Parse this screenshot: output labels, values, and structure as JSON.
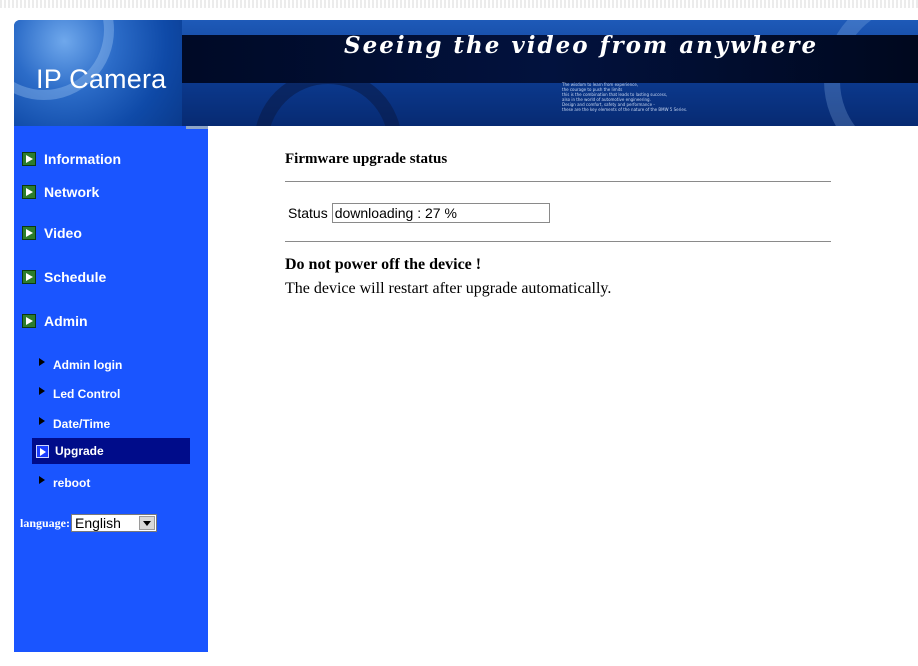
{
  "banner": {
    "title": "IP Camera",
    "slogan": "Seeing the video from anywhere",
    "fine_print": [
      "The wisdom to learn from experience,",
      "the courage to push the limits",
      "this is the combination that leads to lasting success,",
      "also in the world of automotive engineering.",
      "Design and comfort, safety and performance -",
      "these are the key elements of the nature of the BMW 5 Series."
    ]
  },
  "sidebar": {
    "menu": [
      {
        "label": "Information"
      },
      {
        "label": "Network"
      },
      {
        "label": "Video"
      },
      {
        "label": "Schedule"
      },
      {
        "label": "Admin"
      }
    ],
    "admin_submenu": [
      {
        "label": "Admin login",
        "active": false
      },
      {
        "label": "Led Control",
        "active": false
      },
      {
        "label": "Date/Time",
        "active": false
      },
      {
        "label": "Upgrade",
        "active": true
      },
      {
        "label": "reboot",
        "active": false
      }
    ],
    "language": {
      "label": "language:",
      "selected": "English"
    }
  },
  "main": {
    "heading": "Firmware upgrade status",
    "status_label": "Status",
    "status_value": "downloading : 27 %",
    "warning": "Do not power off the device !",
    "note": "The device will restart after upgrade automatically."
  },
  "colors": {
    "sidebar_bg": "#1a55ff",
    "active_item_bg": "#000c8a",
    "banner_blue": "#0c3a8f"
  }
}
